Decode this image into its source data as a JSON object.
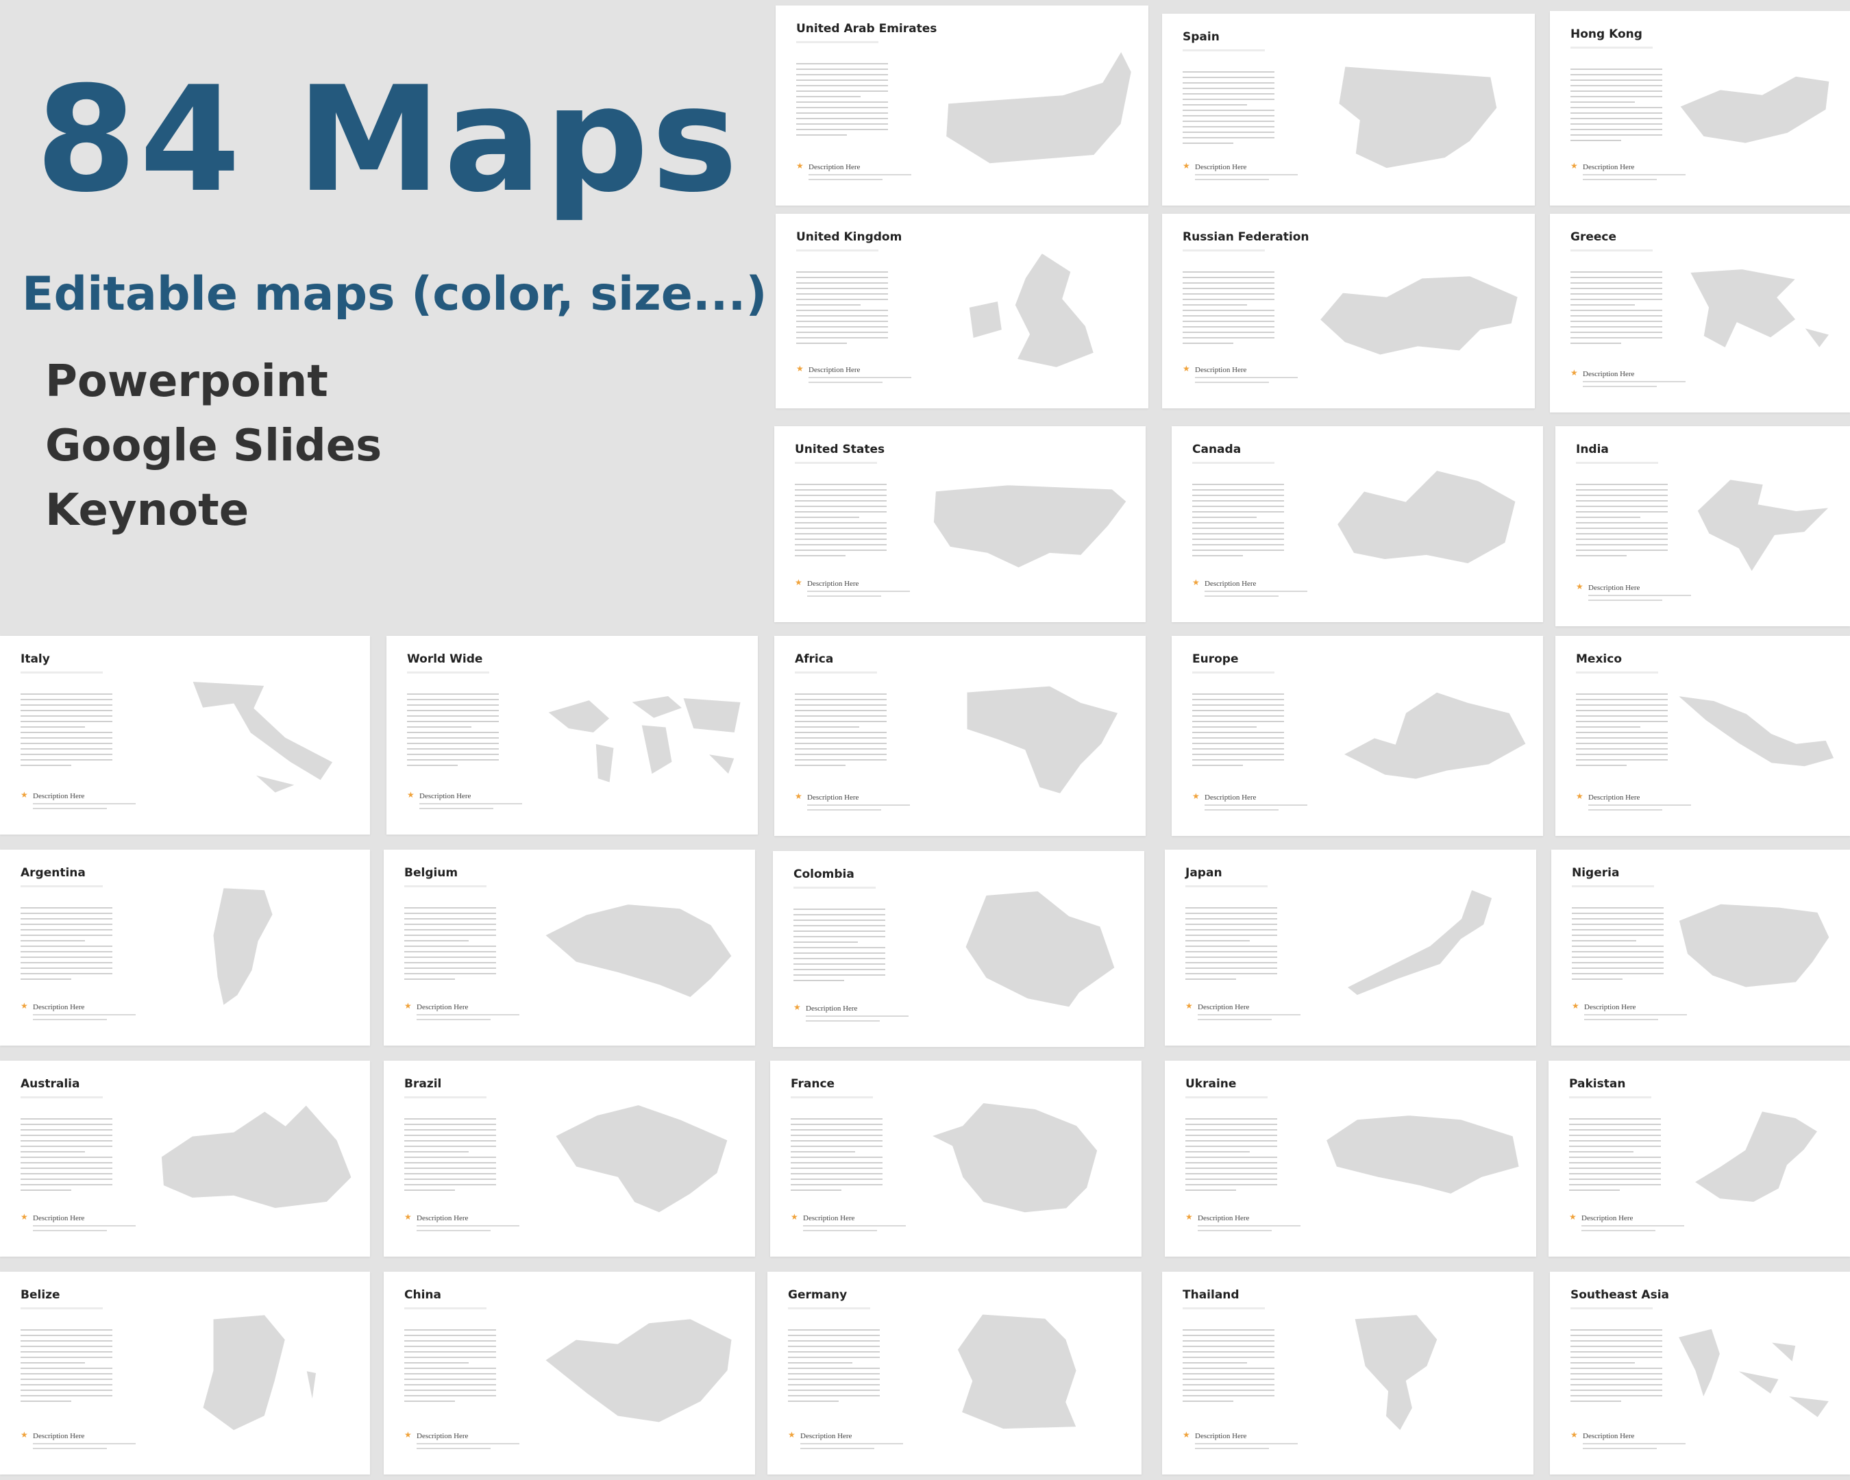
{
  "hero": {
    "title": "84 Maps",
    "subtitle": "Editable maps (color, size...)",
    "platforms": [
      "Powerpoint",
      "Google Slides",
      "Keynote"
    ]
  },
  "slides": [
    {
      "title": "United Arab Emirates",
      "caption": "Description Here",
      "map_icon": "uae-map-icon"
    },
    {
      "title": "Spain",
      "caption": "Description Here",
      "map_icon": "spain-map-icon"
    },
    {
      "title": "Hong Kong",
      "caption": "Description Here",
      "map_icon": "hong-kong-map-icon"
    },
    {
      "title": "United Kingdom",
      "caption": "Description Here",
      "map_icon": "united-kingdom-map-icon"
    },
    {
      "title": "Russian Federation",
      "caption": "Description Here",
      "map_icon": "russia-map-icon"
    },
    {
      "title": "Greece",
      "caption": "Description Here",
      "map_icon": "greece-map-icon"
    },
    {
      "title": "United States",
      "caption": "Description Here",
      "map_icon": "united-states-map-icon"
    },
    {
      "title": "Canada",
      "caption": "Description Here",
      "map_icon": "canada-map-icon"
    },
    {
      "title": "India",
      "caption": "Description Here",
      "map_icon": "india-map-icon"
    },
    {
      "title": "Italy",
      "caption": "Description Here",
      "map_icon": "italy-map-icon"
    },
    {
      "title": "World Wide",
      "caption": "Description Here",
      "map_icon": "world-map-icon"
    },
    {
      "title": "Africa",
      "caption": "Description Here",
      "map_icon": "africa-map-icon"
    },
    {
      "title": "Europe",
      "caption": "Description Here",
      "map_icon": "europe-map-icon"
    },
    {
      "title": "Mexico",
      "caption": "Description Here",
      "map_icon": "mexico-map-icon"
    },
    {
      "title": "Argentina",
      "caption": "Description Here",
      "map_icon": "argentina-map-icon"
    },
    {
      "title": "Belgium",
      "caption": "Description Here",
      "map_icon": "belgium-map-icon"
    },
    {
      "title": "Colombia",
      "caption": "Description Here",
      "map_icon": "colombia-map-icon"
    },
    {
      "title": "Japan",
      "caption": "Description Here",
      "map_icon": "japan-map-icon"
    },
    {
      "title": "Nigeria",
      "caption": "Description Here",
      "map_icon": "nigeria-map-icon"
    },
    {
      "title": "Australia",
      "caption": "Description Here",
      "map_icon": "australia-map-icon"
    },
    {
      "title": "Brazil",
      "caption": "Description Here",
      "map_icon": "brazil-map-icon"
    },
    {
      "title": "France",
      "caption": "Description Here",
      "map_icon": "france-map-icon"
    },
    {
      "title": "Ukraine",
      "caption": "Description Here",
      "map_icon": "ukraine-map-icon"
    },
    {
      "title": "Pakistan",
      "caption": "Description Here",
      "map_icon": "pakistan-map-icon"
    },
    {
      "title": "Belize",
      "caption": "Description Here",
      "map_icon": "belize-map-icon"
    },
    {
      "title": "China",
      "caption": "Description Here",
      "map_icon": "china-map-icon"
    },
    {
      "title": "Germany",
      "caption": "Description Here",
      "map_icon": "germany-map-icon"
    },
    {
      "title": "Thailand",
      "caption": "Description Here",
      "map_icon": "thailand-map-icon"
    },
    {
      "title": "Southeast Asia",
      "caption": "Description Here",
      "map_icon": "southeast-asia-map-icon"
    }
  ],
  "colors": {
    "background": "#e3e3e3",
    "title": "#24597d",
    "platform_text": "#333333",
    "map_fill": "#dadada",
    "marker": "#f0a23a"
  }
}
